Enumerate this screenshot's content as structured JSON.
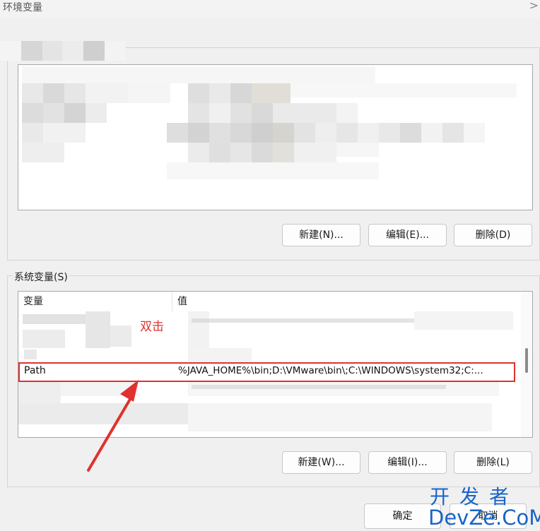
{
  "window": {
    "title": "环境变量",
    "close_glyph": ">"
  },
  "user_vars": {
    "buttons": {
      "new": "新建(N)...",
      "edit": "编辑(E)...",
      "delete": "删除(D)"
    }
  },
  "system_vars": {
    "group_label": "系统变量(S)",
    "columns": {
      "name": "变量",
      "value": "值"
    },
    "selected_row": {
      "name": "Path",
      "value": "%JAVA_HOME%\\bin;D:\\VMware\\bin\\;C:\\WINDOWS\\system32;C:..."
    },
    "buttons": {
      "new": "新建(W)...",
      "edit": "编辑(I)...",
      "delete": "删除(L)"
    }
  },
  "dialog_buttons": {
    "ok": "确定",
    "cancel": "取消"
  },
  "annotation": {
    "label": "双击",
    "color": "#e0312e"
  },
  "watermark": {
    "top": "开发者",
    "bottom": "DevZe.CoM",
    "color": "#1a63c9"
  }
}
